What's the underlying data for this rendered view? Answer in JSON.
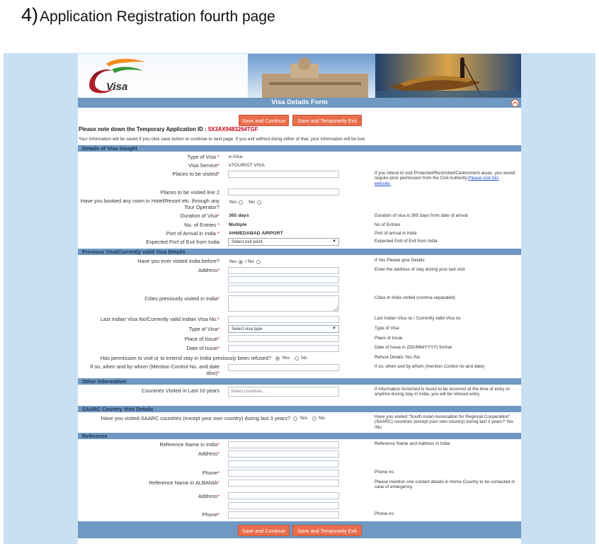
{
  "caption": {
    "number": "4)",
    "text": "Application Registration fourth page"
  },
  "logo": {
    "text": "e",
    "subtext": "Visa"
  },
  "form": {
    "title": "Visa Details Form",
    "save_continue": "Save and Continue",
    "save_temp_exit": "Save and Temporarily Exit",
    "temp_id_label": "Please note down the Temporary Application ID :",
    "temp_id_value": "5X3AX9483264TGF",
    "notice": "Your Information will be saved if you click save button or continue to next page. If you exit without doing either of that, your information will be lost."
  },
  "sections": {
    "visa_sought": "Details of Visa Sought",
    "previous_visa": "Previous Visa/Currently valid Visa Details",
    "other": "Other Information",
    "saarc": "SAARC Country Visit Details",
    "reference": "Reference"
  },
  "visa_sought": {
    "type_label": "Type of Visa",
    "type_value": "e-Visa",
    "service_label": "Visa Service",
    "service_value": "eTOURIST VISA",
    "places_label": "Places to be visited",
    "places_help_text": "If you intend to visit Protected/Restricted/Cantonment areas, you would require prior permission from the Civil Authority.",
    "places_help_link": "Please visit this website.",
    "places2_label": "Places to be visited line 2",
    "hotel_label": "Have you booked any room in Hotel/Resort etc. through any Tour Operator?",
    "hotel_yes": "Yes",
    "hotel_no": "No",
    "duration_label": "Duration of Visa",
    "duration_value": "365 days",
    "duration_help": "Duration of visa is 365 days from date of arrival",
    "entries_label": "No. of Entries",
    "entries_value": "Multiple",
    "entries_help": "No of Entries",
    "arrival_label": "Port of Arrival in India",
    "arrival_value": "AHMEDABAD AIRPORT",
    "arrival_help": "Port of arrival in India",
    "exit_label": "Expected Port of Exit from India",
    "exit_value": "Select exit point",
    "exit_help": "Expected Port of Exit from India"
  },
  "previous_visa": {
    "visited_label": "Have you ever visited India before?",
    "visited_yes": "Yes",
    "visited_no": "/ No",
    "visited_help": "If Yes Please give Details",
    "address_label": "Address",
    "address_help": "Enter the address of stay during your last visit",
    "cities_label": "Cities previously visited in India",
    "cities_help": "Cities in India visited (comma separated)",
    "visa_no_label": "Last Indian Visa No/Currently valid Indian Visa No.",
    "visa_no_help": "Last Indian Visa no / Currently valid Visa no",
    "type_label": "Type of Visa",
    "type_value": "Select visa type",
    "type_help": "Type of Visa",
    "place_label": "Place of Issue",
    "place_help": "Place of Issue",
    "date_label": "Date of Issue",
    "date_help": "Date of Issue in (DD/MM/YYYY) format",
    "refused_label": "Has permission to visit or to extend stay in India previously been refused?",
    "refused_yes": "Yes",
    "refused_no": "No",
    "refused_help": "Refuse Details Yes /No",
    "control_label": "If so, when and by whom (Mention Control No. and date also)",
    "control_help": "If so, when and by whom (mention Control no and date)"
  },
  "other": {
    "countries_label": "Countries Visited in Last 10 years",
    "countries_placeholder": "Select countries...",
    "countries_help": "If information furnished is found to be incorrect at the time of entry or anytime during stay in India, you will be refused entry."
  },
  "saarc": {
    "label": "Have you visited SAARC countries (except your own country) during last 3 years?",
    "yes": "Yes",
    "no": "No",
    "help": "Have you visited \"South Asian Association for Regional Cooperation\" (SAARC) countries (except your own country) during last 3 years? Yes /No"
  },
  "reference": {
    "india_name_label": "Reference Name in India",
    "india_name_help": "Reference Name and Address in India",
    "address_label": "Address",
    "phone_label": "Phone",
    "phone_help": "Phone no",
    "home_name_label": "Reference Name in ALBANIA",
    "home_name_help": "Please mention one contact details in Home Country to be contacted in case of emergency",
    "address2_label": "Address",
    "phone2_label": "Phone",
    "phone2_help": "Phone no"
  }
}
